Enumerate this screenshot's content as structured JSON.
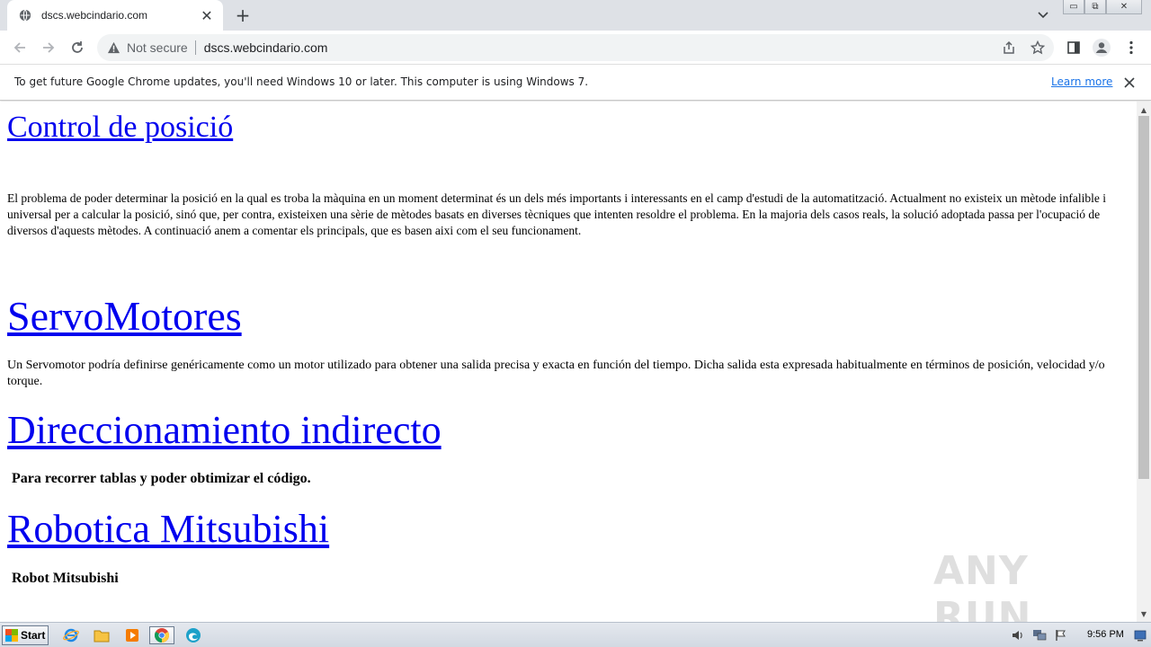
{
  "browser": {
    "tab_title": "dscs.webcindario.com",
    "tab_close_glyph": "✕",
    "new_tab_glyph": "+",
    "security_label": "Not secure",
    "url": "dscs.webcindario.com",
    "window_buttons": [
      "▭",
      "⧉",
      "✕"
    ]
  },
  "infobar": {
    "message": "To get future Google Chrome updates, you'll need Windows 10 or later. This computer is using Windows 7.",
    "link": "Learn more"
  },
  "page": {
    "sections": [
      {
        "heading": "Control de posició",
        "text": "El problema de poder determinar la posició en la qual es troba la màquina en un moment determinat és un dels més importants i interessants en el camp d'estudi de la automatització. Actualment no existeix un mètode infalible i universal per a calcular la posició, sinó que, per contra, existeixen una sèrie de mètodes basats en diverses tècniques que intenten resoldre el problema. En la majoria dels casos reals, la solució adoptada passa per l'ocupació de diversos d'aquests mètodes. A continuació anem a comentar els principals, que es basen aixi com el seu funcionament."
      },
      {
        "heading": "ServoMotores",
        "text": "Un Servomotor podría definirse genéricamente como un motor utilizado para obtener una salida precisa y exacta en función del tiempo. Dicha salida esta expresada habitualmente en términos de posición, velocidad y/o torque."
      },
      {
        "heading": "Direccionamiento indirecto",
        "text": "Para recorrer tablas y poder obtimizar el código."
      },
      {
        "heading": "Robotica Mitsubishi",
        "text": "Robot Mitsubishi"
      }
    ],
    "watermark": "ANY RUN"
  },
  "scrollbar": {
    "up_glyph": "▲",
    "down_glyph": "▼"
  },
  "taskbar": {
    "start_label": "Start",
    "clock": "9:56 PM"
  },
  "colors": {
    "link": "#0000ee",
    "chrome_tabstrip": "#dee1e6",
    "info_link": "#1a73e8"
  }
}
